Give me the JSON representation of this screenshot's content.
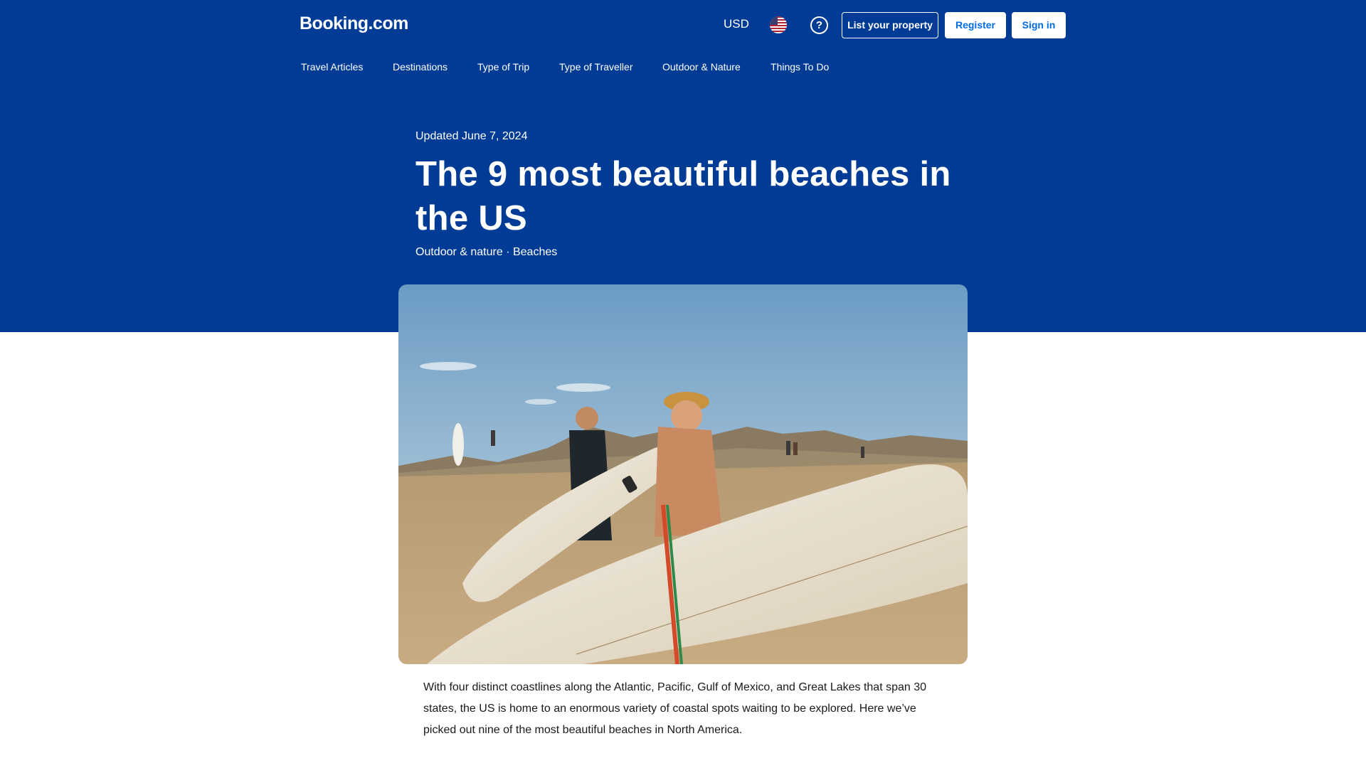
{
  "header": {
    "logo": "Booking.com",
    "currency": "USD",
    "flag_icon": "us-flag-icon",
    "help_icon": "question-circle-icon",
    "list_property_label": "List your property",
    "register_label": "Register",
    "signin_label": "Sign in"
  },
  "nav": {
    "items": [
      {
        "label": "Travel Articles"
      },
      {
        "label": "Destinations"
      },
      {
        "label": "Type of Trip"
      },
      {
        "label": "Type of Traveller"
      },
      {
        "label": "Outdoor & Nature"
      },
      {
        "label": "Things To Do"
      }
    ]
  },
  "article": {
    "updated": "Updated June 7, 2024",
    "title": "The 9 most beautiful beaches in the US",
    "tag_primary": "Outdoor & nature",
    "tag_separator": " · ",
    "tag_secondary": "Beaches",
    "intro": "With four distinct coastlines along the Atlantic, Pacific, Gulf of Mexico, and Great Lakes that span 30 states, the US is home to an enormous variety of coastal spots waiting to be explored. Here we’ve picked out nine of the most beautiful beaches in North America."
  },
  "colors": {
    "brand_blue": "#003b95",
    "button_text_blue": "#006ce4",
    "white": "#ffffff"
  }
}
